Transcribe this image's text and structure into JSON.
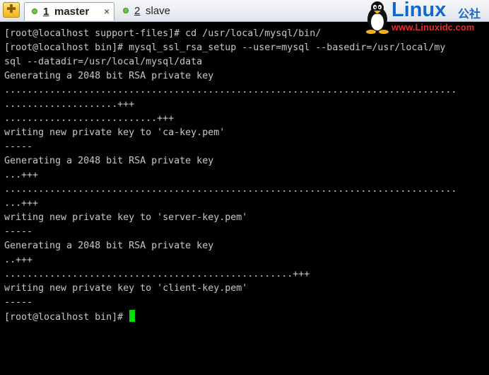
{
  "tabs": {
    "new_tab_icon": "new-session-icon",
    "items": [
      {
        "number": "1",
        "name": " master",
        "status": "connected",
        "close": "×"
      },
      {
        "number": "2",
        "name": " slave",
        "status": "connected"
      }
    ]
  },
  "watermark": {
    "brand": "Linux",
    "brand_cn": "公社",
    "url": "www.Linuxidc.com"
  },
  "terminal": {
    "lines": [
      "[root@localhost support-files]# cd /usr/local/mysql/bin/",
      "[root@localhost bin]# mysql_ssl_rsa_setup --user=mysql --basedir=/usr/local/my",
      "sql --datadir=/usr/local/mysql/data",
      "Generating a 2048 bit RSA private key",
      "................................................................................",
      "....................+++",
      "...........................+++",
      "writing new private key to 'ca-key.pem'",
      "-----",
      "Generating a 2048 bit RSA private key",
      "...+++",
      "................................................................................",
      "...+++",
      "writing new private key to 'server-key.pem'",
      "-----",
      "Generating a 2048 bit RSA private key",
      "..+++",
      "...................................................+++",
      "writing new private key to 'client-key.pem'",
      "-----"
    ],
    "prompt": "[root@localhost bin]# ",
    "colors": {
      "background": "#000000",
      "text": "#c8c8c8",
      "cursor": "#00e000"
    }
  }
}
